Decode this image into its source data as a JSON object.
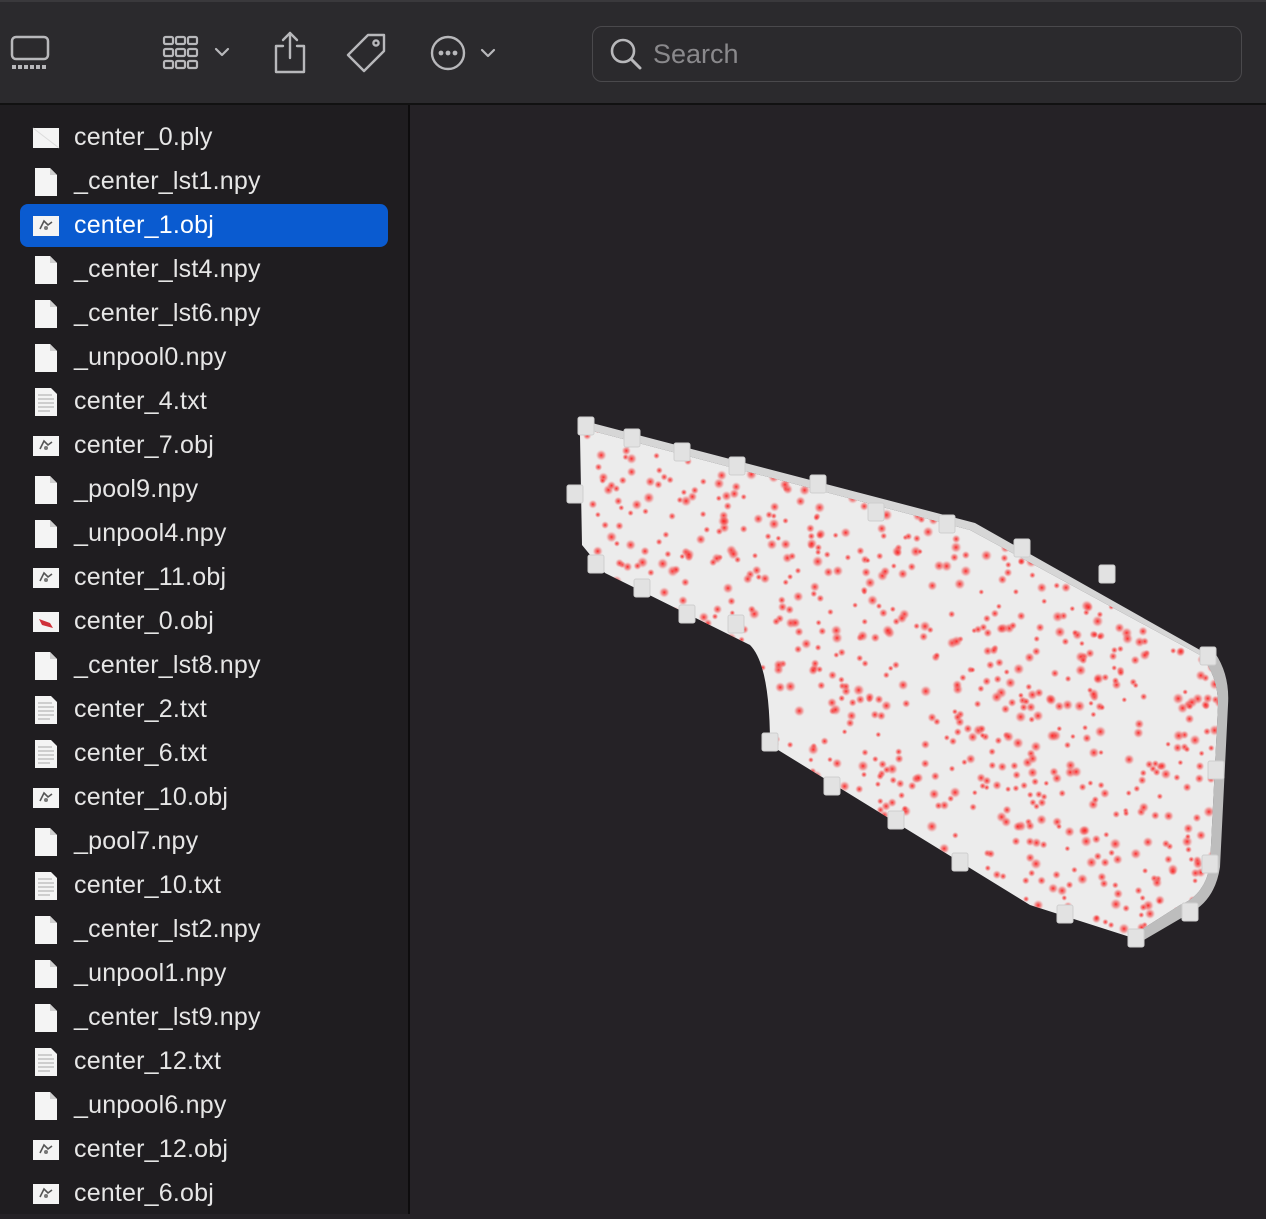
{
  "toolbar": {
    "search_placeholder": "Search",
    "buttons": [
      {
        "name": "view-mode-icon"
      },
      {
        "name": "group-by-icon"
      },
      {
        "name": "share-icon"
      },
      {
        "name": "tag-icon"
      },
      {
        "name": "more-actions-icon"
      }
    ]
  },
  "sidebar": {
    "selected_index": 2,
    "files": [
      {
        "label": "center_0.ply",
        "icon": "ply-file-icon"
      },
      {
        "label": "_center_lst1.npy",
        "icon": "document-icon"
      },
      {
        "label": "center_1.obj",
        "icon": "obj-file-icon"
      },
      {
        "label": "_center_lst4.npy",
        "icon": "document-icon"
      },
      {
        "label": "_center_lst6.npy",
        "icon": "document-icon"
      },
      {
        "label": "_unpool0.npy",
        "icon": "document-icon"
      },
      {
        "label": "center_4.txt",
        "icon": "text-file-icon"
      },
      {
        "label": "center_7.obj",
        "icon": "obj-file-icon"
      },
      {
        "label": "_pool9.npy",
        "icon": "document-icon"
      },
      {
        "label": "_unpool4.npy",
        "icon": "document-icon"
      },
      {
        "label": "center_11.obj",
        "icon": "obj-file-icon"
      },
      {
        "label": "center_0.obj",
        "icon": "obj-file-red-icon"
      },
      {
        "label": "_center_lst8.npy",
        "icon": "document-icon"
      },
      {
        "label": "center_2.txt",
        "icon": "text-file-icon"
      },
      {
        "label": "center_6.txt",
        "icon": "text-file-icon"
      },
      {
        "label": "center_10.obj",
        "icon": "obj-file-icon"
      },
      {
        "label": "_pool7.npy",
        "icon": "document-icon"
      },
      {
        "label": "center_10.txt",
        "icon": "text-file-icon"
      },
      {
        "label": "_center_lst2.npy",
        "icon": "document-icon"
      },
      {
        "label": "_unpool1.npy",
        "icon": "document-icon"
      },
      {
        "label": "_center_lst9.npy",
        "icon": "document-icon"
      },
      {
        "label": "center_12.txt",
        "icon": "text-file-icon"
      },
      {
        "label": "_unpool6.npy",
        "icon": "document-icon"
      },
      {
        "label": "center_12.obj",
        "icon": "obj-file-icon"
      },
      {
        "label": "center_6.obj",
        "icon": "obj-file-icon"
      }
    ]
  },
  "preview": {
    "subject": "3d-mesh-model",
    "colors": {
      "surface": "#ececec",
      "dots": "#f05050",
      "selection": "#0a5bd0"
    }
  }
}
